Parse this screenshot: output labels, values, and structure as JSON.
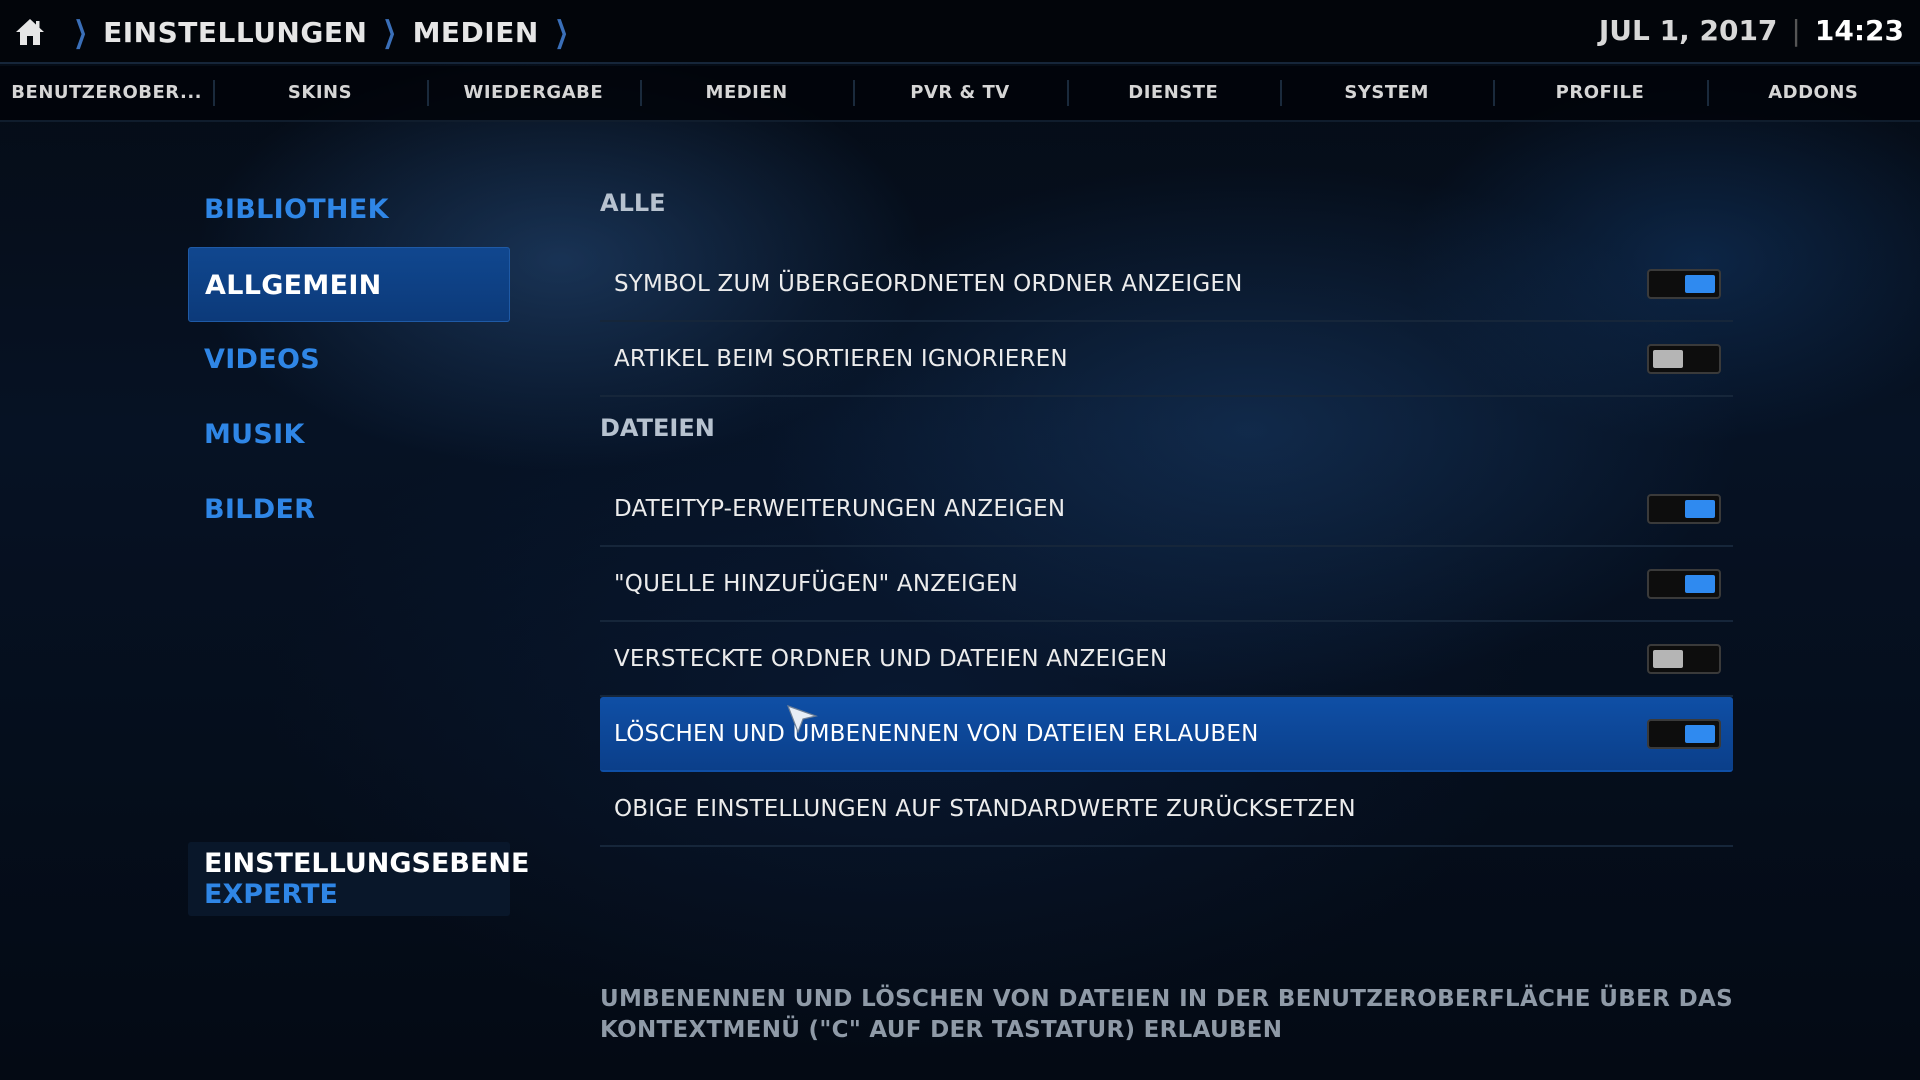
{
  "breadcrumb": {
    "home_icon": "home-icon",
    "items": [
      "EINSTELLUNGEN",
      "MEDIEN"
    ]
  },
  "clock": {
    "date": "JUL 1, 2017",
    "separator": "|",
    "time": "14:23"
  },
  "tabs": [
    "BENUTZEROBER...",
    "SKINS",
    "WIEDERGABE",
    "MEDIEN",
    "PVR & TV",
    "DIENSTE",
    "SYSTEM",
    "PROFILE",
    "ADDONS"
  ],
  "menu": {
    "items": [
      "BIBLIOTHEK",
      "ALLGEMEIN",
      "VIDEOS",
      "MUSIK",
      "BILDER"
    ],
    "active": "ALLGEMEIN"
  },
  "settings_level": {
    "title": "EINSTELLUNGSEBENE",
    "value": "EXPERTE"
  },
  "settings": {
    "section_all": "ALLE",
    "section_files": "DATEIEN",
    "rows": [
      {
        "label": "SYMBOL ZUM ÜBERGEORDNETEN ORDNER ANZEIGEN",
        "state": "on"
      },
      {
        "label": "ARTIKEL BEIM SORTIEREN IGNORIEREN",
        "state": "off"
      },
      {
        "label": "DATEITYP-ERWEITERUNGEN ANZEIGEN",
        "state": "on"
      },
      {
        "label": "\"QUELLE HINZUFÜGEN\" ANZEIGEN",
        "state": "on"
      },
      {
        "label": "VERSTECKTE ORDNER UND DATEIEN ANZEIGEN",
        "state": "off"
      },
      {
        "label": "LÖSCHEN UND UMBENENNEN VON DATEIEN ERLAUBEN",
        "state": "on"
      }
    ],
    "reset_label": "OBIGE EINSTELLUNGEN AUF STANDARDWERTE ZURÜCKSETZEN",
    "focused_row": "LÖSCHEN UND UMBENENNEN VON DATEIEN ERLAUBEN"
  },
  "description": "UMBENENNEN UND LÖSCHEN VON DATEIEN IN DER BENUTZEROBERFLÄCHE ÜBER DAS KONTEXTMENÜ (\"C\" AUF DER TASTATUR) ERLAUBEN",
  "colors": {
    "accent": "#2f86e6",
    "focus_bg": "#0f4fa6",
    "toggle_on": "#2f8af0",
    "toggle_off": "#b5b5b5"
  }
}
